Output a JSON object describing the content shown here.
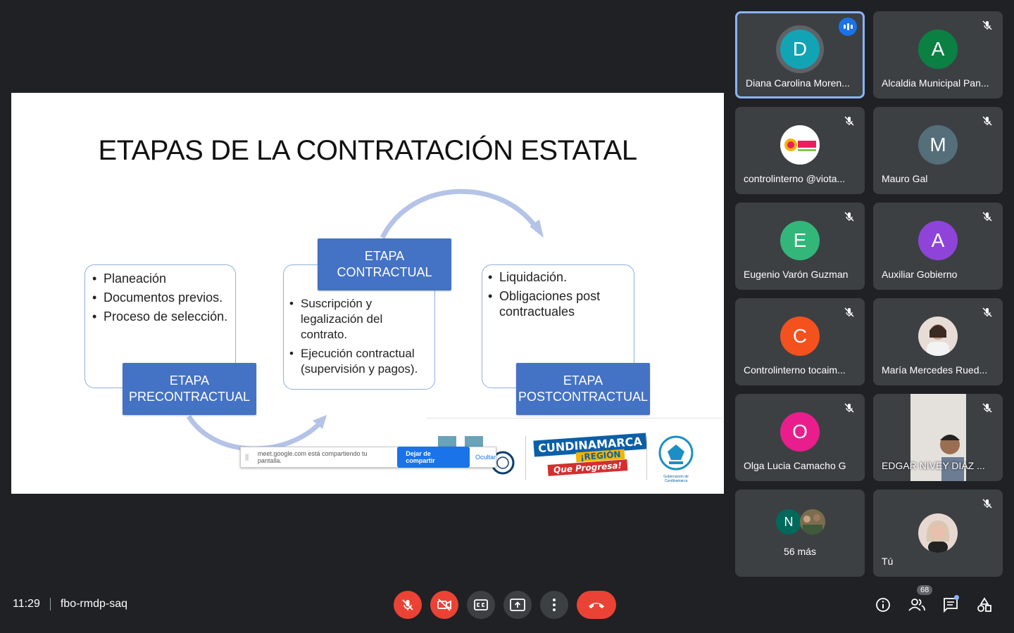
{
  "slide": {
    "title": "ETAPAS DE LA CONTRATACIÓN ESTATAL",
    "box1_items": [
      "Planeación",
      "Documentos previos.",
      "Proceso de selección."
    ],
    "box2_items": [
      "Suscripción y legalización del contrato.",
      "Ejecución contractual (supervisión y pagos)."
    ],
    "box3_items": [
      "Liquidación.",
      "Obligaciones post contractuales"
    ],
    "tag_pre": "ETAPA PRECONTRACTUAL",
    "tag_con": "ETAPA CONTRACTUAL",
    "tag_post": "ETAPA POSTCONTRACTUAL",
    "logo_line1": "CUNDINAMARCA",
    "logo_line2": "¡REGIÓN",
    "logo_line3": "Que Progresa!",
    "gob_text": "Gobernación de Cundinamarca"
  },
  "share_banner": {
    "message": "meet.google.com está compartiendo tu pantalla.",
    "stop_label": "Dejar de compartir",
    "hide_label": "Ocultar"
  },
  "participants": [
    {
      "initial": "D",
      "name": "Diana Carolina Moren...",
      "color": "#12a4b4",
      "speaking": true
    },
    {
      "initial": "A",
      "name": "Alcaldia Municipal Pan...",
      "color": "#0b8043"
    },
    {
      "initial": "",
      "name": "controlinterno @viota...",
      "color": "#ffffff",
      "image": "viota-logo"
    },
    {
      "initial": "M",
      "name": "Mauro Gal",
      "color": "#546e7a"
    },
    {
      "initial": "E",
      "name": "Eugenio Varón Guzman",
      "color": "#33b679"
    },
    {
      "initial": "A",
      "name": "Auxiliar Gobierno",
      "color": "#8e44d8"
    },
    {
      "initial": "C",
      "name": "Controlinterno tocaim...",
      "color": "#f4511e"
    },
    {
      "initial": "",
      "name": "María Mercedes Rued...",
      "color": "#c9a18a",
      "image": "photo-woman"
    },
    {
      "initial": "O",
      "name": "Olga Lucia Camacho G",
      "color": "#e91e8c"
    },
    {
      "initial": "",
      "name": "EDGAR NIVEY DIAZ ...",
      "color": "#b8b0a8",
      "image": "video-man"
    },
    {
      "initial": "N",
      "name": "56 más",
      "color": "#00695c",
      "group": true
    },
    {
      "initial": "",
      "name": "Tú",
      "color": "#d8b8b0",
      "image": "photo-self"
    }
  ],
  "meeting": {
    "time": "11:29",
    "code": "fbo-rmdp-saq",
    "participant_count": "68"
  },
  "icons": {
    "mic": "mic-off-icon",
    "cam": "camera-off-icon",
    "captions": "captions-icon",
    "present": "present-screen-icon",
    "more": "more-options-icon",
    "hangup": "hang-up-icon",
    "info": "info-icon",
    "people": "people-icon",
    "chat": "chat-icon",
    "activities": "activities-icon"
  },
  "colors": {
    "background": "#202124",
    "tile": "#3c4043",
    "danger": "#ea4335",
    "slide_blue": "#4472c4",
    "active_border": "#8ab4f8"
  }
}
